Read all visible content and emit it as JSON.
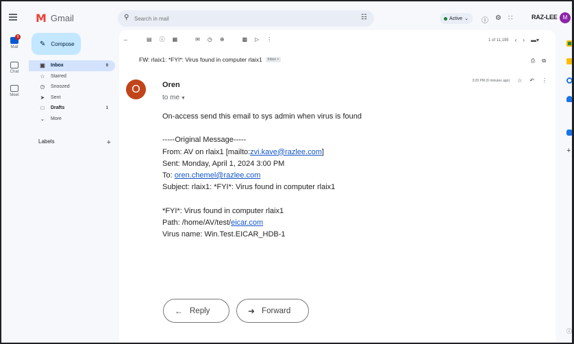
{
  "app": {
    "name": "Gmail",
    "logo_letter": "M",
    "brand": "RAZ-LEE",
    "user_initial": "M",
    "colors": {
      "accent": "#0b57d0",
      "compose_bg": "#c2e7ff",
      "selected_bg": "#d3e3fd",
      "sender_avatar": "#c1441b",
      "user_avatar": "#8e24aa",
      "active": "#188038"
    }
  },
  "rail": {
    "items": [
      {
        "label": "Mail",
        "badge": "9"
      },
      {
        "label": "Chat"
      },
      {
        "label": "Meet"
      }
    ]
  },
  "search": {
    "placeholder": "Search in mail"
  },
  "status": {
    "label": "Active"
  },
  "sidebar": {
    "compose_label": "Compose",
    "items": [
      {
        "label": "Inbox",
        "count": "9",
        "icon": "inbox-icon"
      },
      {
        "label": "Starred",
        "count": "",
        "icon": "star-icon"
      },
      {
        "label": "Snoozed",
        "count": "",
        "icon": "clock-icon"
      },
      {
        "label": "Sent",
        "count": "",
        "icon": "send-icon"
      },
      {
        "label": "Drafts",
        "count": "1",
        "icon": "draft-icon"
      },
      {
        "label": "More",
        "count": "",
        "icon": "chevron-down-icon"
      }
    ],
    "labels_heading": "Labels"
  },
  "pager": {
    "text": "1 of 11,195"
  },
  "email": {
    "subject": "FW: rlaix1: *FYI*: Virus found in computer rlaix1",
    "chip": "Inbox ×",
    "sender": "Oren",
    "sender_initial": "O",
    "to_line": "to me",
    "time": "3:20 PM (0 minutes ago)",
    "intro": "On-access send this email to sys admin when virus is found",
    "orig_header": "-----Original Message-----",
    "from_prefix": "From: AV on rlaix1 [mailto:",
    "from_link": "zvi.kave@razlee.com",
    "from_suffix": "]",
    "sent": "Sent: Monday, April 1, 2024 3:00 PM",
    "to_prefix": "To: ",
    "to_link": "oren.chemel@razlee.com",
    "orig_subject": "Subject: rlaix1: *FYI*: Virus found in computer rlaix1",
    "fyi": "*FYI*: Virus found in computer rlaix1",
    "path_prefix": "Path: /home/AV/test/",
    "path_link": "eicar.com",
    "virus_name": "Virus name: Win.Test.EICAR_HDB-1"
  },
  "actions": {
    "reply": "Reply",
    "forward": "Forward"
  }
}
